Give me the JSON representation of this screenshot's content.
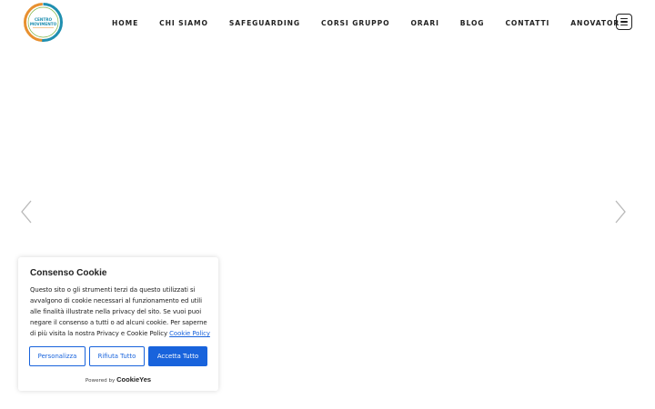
{
  "header": {
    "logo_text_line1": "CENTRO",
    "logo_text_line2": "MOVIMENTO",
    "nav": [
      {
        "label": "HOME"
      },
      {
        "label": "CHI SIAMO"
      },
      {
        "label": "SAFEGUARDING"
      },
      {
        "label": "CORSI GRUPPO"
      },
      {
        "label": "ORARI"
      },
      {
        "label": "BLOG"
      },
      {
        "label": "CONTATTI"
      },
      {
        "label": "ANOVATOR"
      }
    ],
    "menu_icon": "hamburger-menu-icon"
  },
  "slider": {
    "prev_icon": "chevron-left-icon",
    "next_icon": "chevron-right-icon"
  },
  "cookie_banner": {
    "title": "Consenso Cookie",
    "body": "Questo sito o gli strumenti terzi da questo utilizzati si avvalgono di cookie necessari al funzionamento ed utili alle finalità illustrate nella privacy del sito. Se vuoi puoi negare il consenso a tutti o ad alcuni cookie. Per saperne di più visita la nostra Privacy e Cookie Policy",
    "policy_link": "Cookie Policy",
    "buttons": {
      "customize": "Personalizza",
      "reject": "Rifiuta Tutto",
      "accept": "Accetta Tutto"
    },
    "powered_by": "Powered by",
    "brand": "CookieYes"
  },
  "colors": {
    "accent": "#1863dc",
    "text": "#212121",
    "logo_teal": "#1f8fb0",
    "logo_orange": "#e8902f",
    "logo_green": "#7cb342"
  }
}
